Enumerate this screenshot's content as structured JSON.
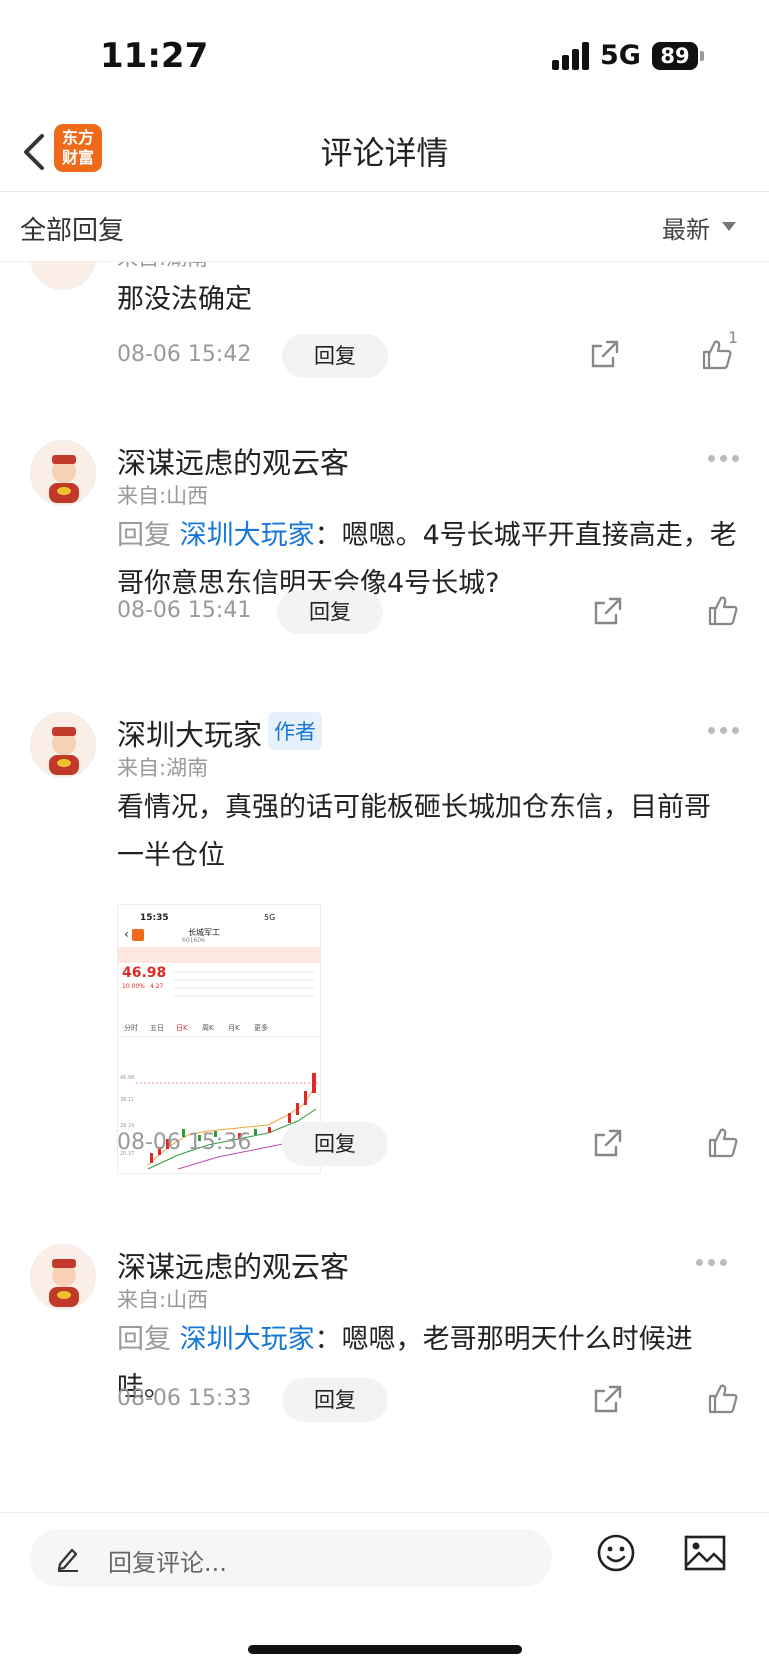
{
  "status_bar": {
    "time": "11:27",
    "network": "5G",
    "battery": "89"
  },
  "nav": {
    "logo_line1": "东方",
    "logo_line2": "财富",
    "title": "评论详情"
  },
  "filter": {
    "all_replies": "全部回复",
    "sort": "最新"
  },
  "comments": [
    {
      "region": "来自:湖南",
      "text": "那没法确定",
      "time": "08-06 15:42",
      "reply_button": "回复",
      "likes": "1"
    },
    {
      "name": "深谋远虑的观云客",
      "region": "来自:山西",
      "reply_prefix": "回复",
      "reply_to": "深圳大玩家",
      "text": "：嗯嗯。4号长城平开直接高走，老哥你意思东信明天会像4号长城?",
      "time": "08-06 15:41",
      "reply_button": "回复"
    },
    {
      "name": "深圳大玩家",
      "tag": "作者",
      "region": "来自:湖南",
      "text": "看情况，真强的话可能板砸长城加仓东信，目前哥一半仓位",
      "time": "08-06 15:36",
      "reply_button": "回复",
      "image": {
        "time": "15:35",
        "network": "5G",
        "stock_name": "长城军工",
        "stock_code": "601606",
        "price": "46.98",
        "change_pct": "10.00%",
        "change": "4.27",
        "tabs": [
          "分时",
          "五日",
          "日K",
          "周K",
          "月K",
          "更多"
        ],
        "y_labels": [
          "46.98",
          "38.11",
          "29.24",
          "20.37"
        ]
      }
    },
    {
      "name": "深谋远虑的观云客",
      "region": "来自:山西",
      "reply_prefix": "回复",
      "reply_to": "深圳大玩家",
      "text": "：嗯嗯，老哥那明天什么时候进哇。",
      "time": "08-06 15:33",
      "reply_button": "回复"
    }
  ],
  "bottom_bar": {
    "placeholder": "回复评论..."
  }
}
